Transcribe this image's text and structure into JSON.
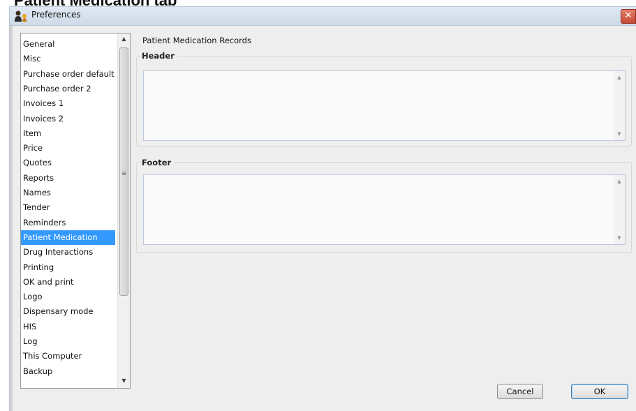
{
  "doc_heading": "Patient Medication tab",
  "window": {
    "title": "Preferences",
    "close_glyph": "✕"
  },
  "categories": [
    {
      "label": "General"
    },
    {
      "label": "Misc"
    },
    {
      "label": "Purchase order default"
    },
    {
      "label": "Purchase order 2"
    },
    {
      "label": "Invoices 1"
    },
    {
      "label": "Invoices 2"
    },
    {
      "label": "Item"
    },
    {
      "label": "Price"
    },
    {
      "label": "Quotes"
    },
    {
      "label": "Reports"
    },
    {
      "label": "Names"
    },
    {
      "label": "Tender"
    },
    {
      "label": "Reminders"
    },
    {
      "label": "Patient Medication",
      "selected": true
    },
    {
      "label": "Drug Interactions"
    },
    {
      "label": "Printing"
    },
    {
      "label": "OK and print"
    },
    {
      "label": "Logo"
    },
    {
      "label": "Dispensary mode"
    },
    {
      "label": "HIS"
    },
    {
      "label": "Log"
    },
    {
      "label": "This Computer"
    },
    {
      "label": "Backup"
    }
  ],
  "content": {
    "section_title": "Patient Medication Records",
    "header_label": "Header",
    "header_value": "",
    "footer_label": "Footer",
    "footer_value": ""
  },
  "buttons": {
    "cancel": "Cancel",
    "ok": "OK"
  },
  "icons": {
    "scroll_up": "▲",
    "scroll_down": "▼"
  },
  "colors": {
    "selection": "#3399ff",
    "close_button": "#c74a33"
  }
}
